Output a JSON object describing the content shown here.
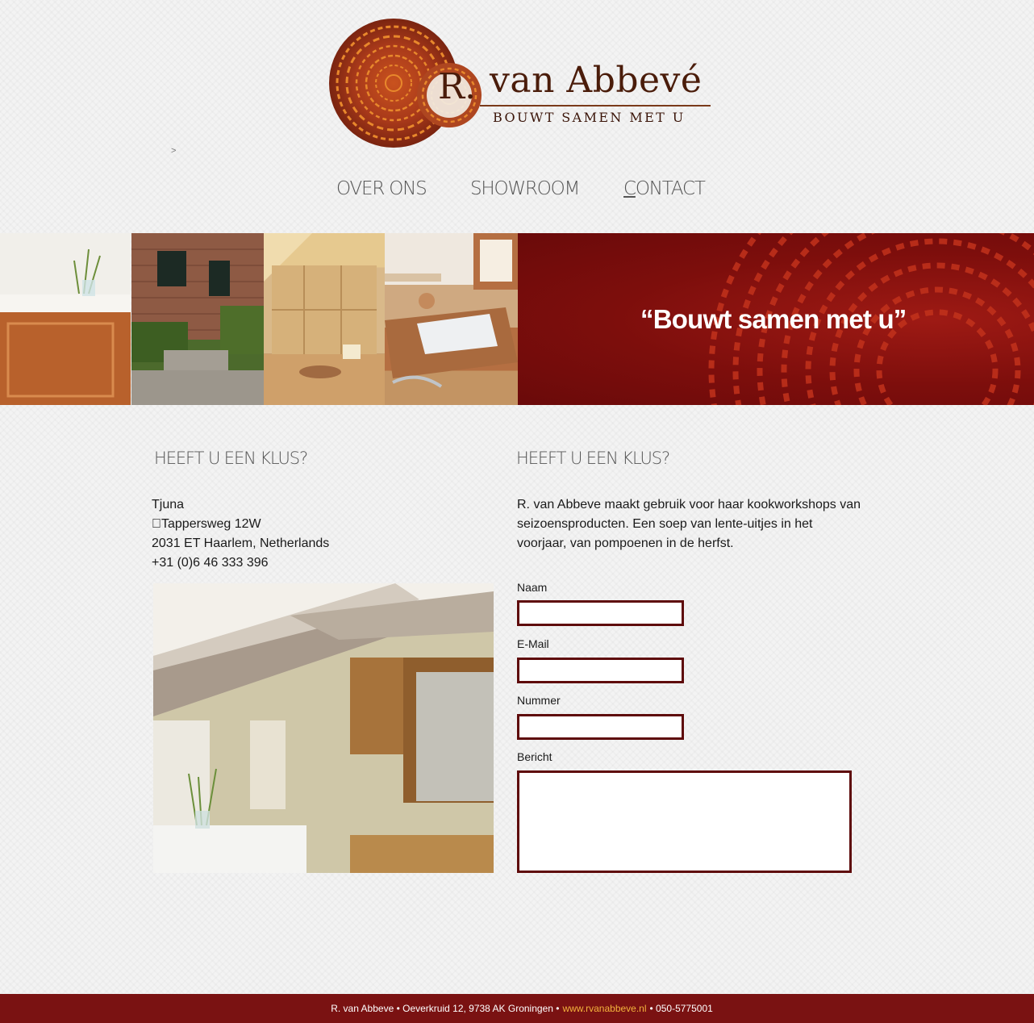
{
  "brand": {
    "r_initial": "R.",
    "name": "van Abbevé",
    "tagline": "BOUWT SAMEN MET U",
    "breadcrumb_separator": ">"
  },
  "nav": {
    "items": [
      "OVER ONS",
      "SHOWROOM",
      "CONTACT"
    ]
  },
  "banner": {
    "quote": "“Bouwt samen met u”"
  },
  "left": {
    "heading": "HEEFT U EEN KLUS?",
    "address_lines": [
      "Tjuna",
      "￾Tappersweg 12W",
      "2031 ET Haarlem, Netherlands",
      "+31 (0)6 46 333 396"
    ]
  },
  "right": {
    "heading": "HEEFT U EEN KLUS?",
    "intro": "R. van Abbeve maakt gebruik voor haar kookworkshops van seizoensproducten. Een soep van lente-uitjes in het voorjaar, van pompoenen in de herfst."
  },
  "form": {
    "name_label": "Naam",
    "email_label": "E-Mail",
    "number_label": "Nummer",
    "message_label": "Bericht"
  },
  "footer": {
    "text_before": "R. van Abbeve • Oeverkruid 12, 9738 AK Groningen •",
    "link": "www.rvanabbeve.nl",
    "text_after": "• 050-5775001"
  },
  "colors": {
    "accent_red": "#7a1212",
    "input_border": "#5e0a0a",
    "footer_link": "#f3b33d",
    "logo_brown": "#4a1c0a"
  },
  "icons": [
    "tree-ring-logo-icon"
  ]
}
